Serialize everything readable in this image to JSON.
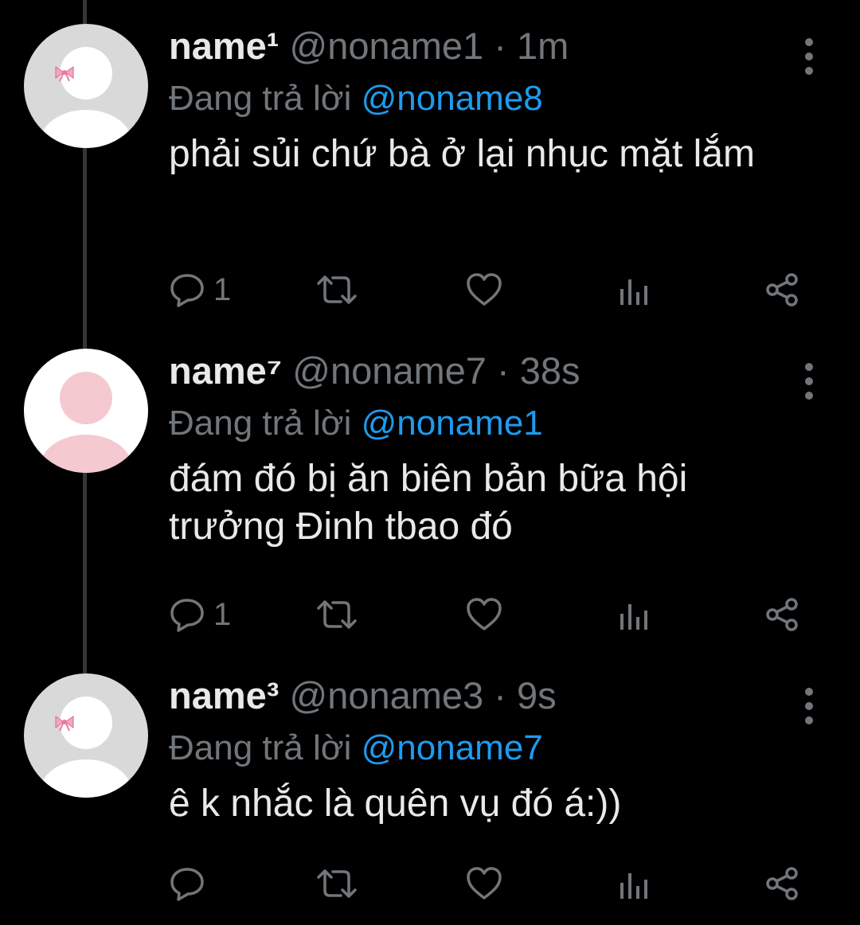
{
  "colors": {
    "background": "#000000",
    "text": "#e7e9ea",
    "secondary": "#71767b",
    "mention": "#1d9bf0",
    "thread_line": "#333639"
  },
  "tweets": [
    {
      "display_name": "name¹",
      "handle": "@noname1",
      "separator": "·",
      "time": "1m",
      "reply_prefix": "Đang trả lời",
      "reply_to": "@noname8",
      "text": "phải sủi chứ bà ở lại nhục mặt lắm",
      "reply_count": "1",
      "avatar": "gray-avatar-with-pink-bow",
      "icons": [
        "reply-icon",
        "retweet-icon",
        "like-icon",
        "analytics-icon",
        "share-icon",
        "more-icon"
      ]
    },
    {
      "display_name": "name⁷",
      "handle": "@noname7",
      "separator": "·",
      "time": "38s",
      "reply_prefix": "Đang trả lời",
      "reply_to": "@noname1",
      "text": "đám đó bị ăn biên bản bữa hội trưởng Đinh tbao đó",
      "reply_count": "1",
      "avatar": "white-avatar-pink-silhouette",
      "icons": [
        "reply-icon",
        "retweet-icon",
        "like-icon",
        "analytics-icon",
        "share-icon",
        "more-icon"
      ]
    },
    {
      "display_name": "name³",
      "handle": "@noname3",
      "separator": "·",
      "time": "9s",
      "reply_prefix": "Đang trả lời",
      "reply_to": "@noname7",
      "text": "ê k nhắc là quên vụ đó á:))",
      "reply_count": "",
      "avatar": "gray-avatar-with-pink-bow",
      "icons": [
        "reply-icon",
        "retweet-icon",
        "like-icon",
        "analytics-icon",
        "share-icon",
        "more-icon"
      ]
    }
  ]
}
